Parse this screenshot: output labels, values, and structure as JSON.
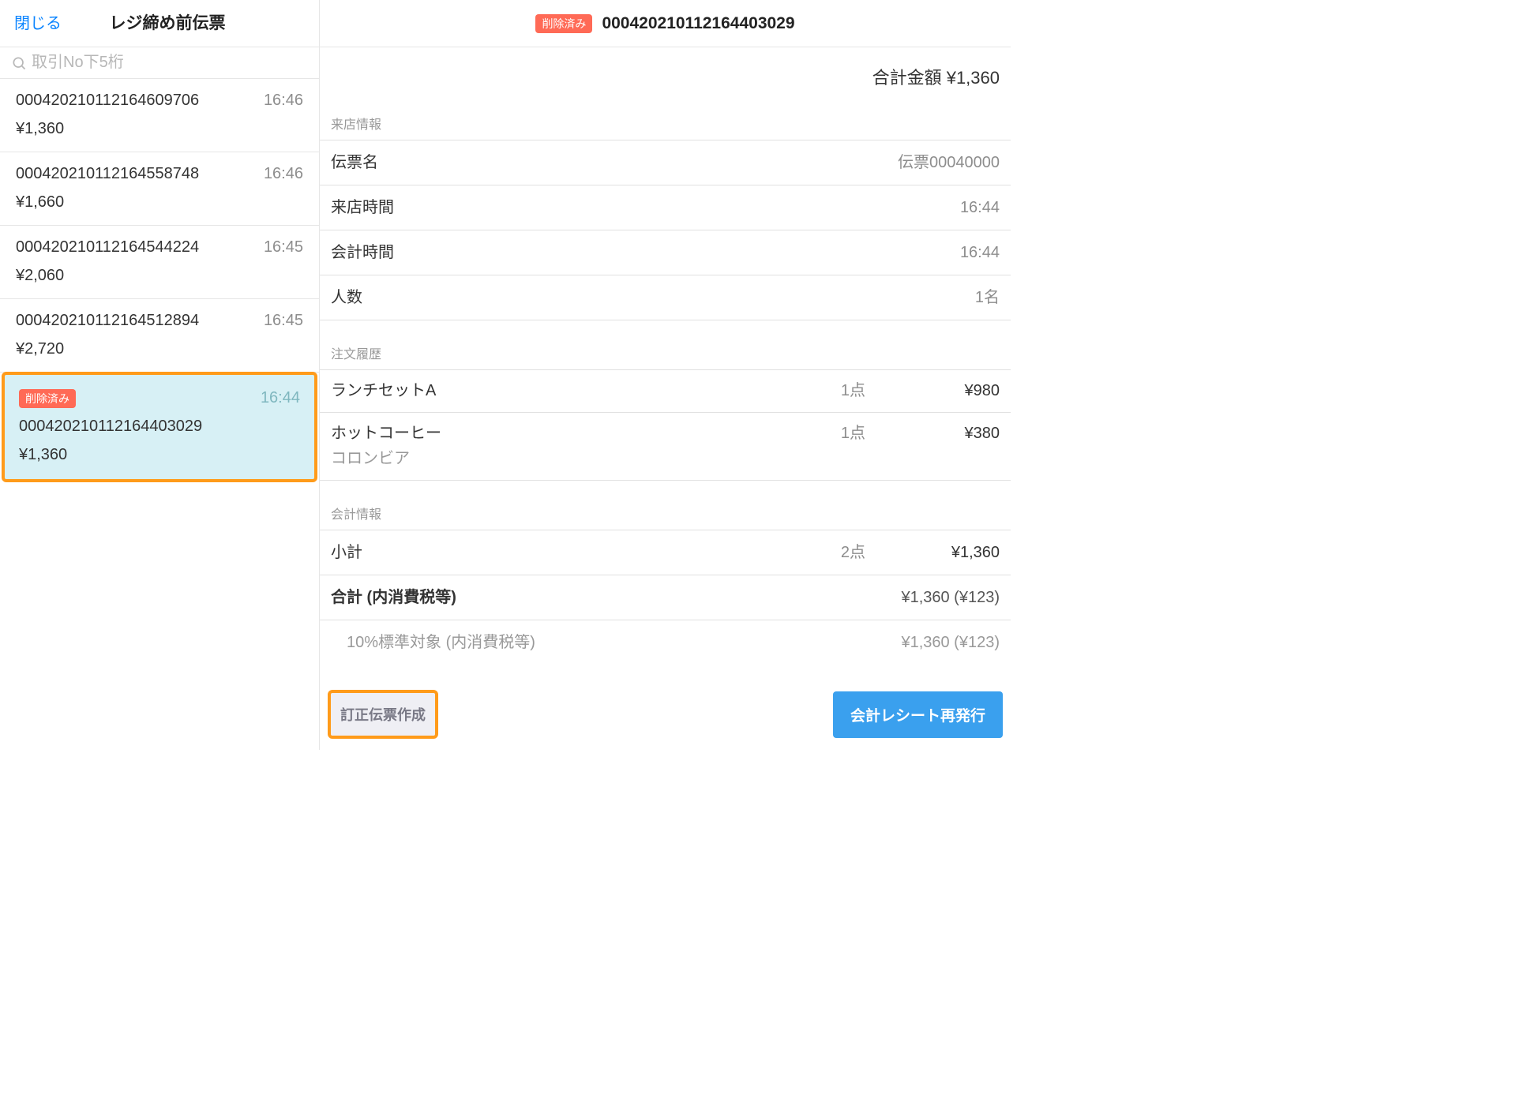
{
  "sidebar": {
    "close_label": "閉じる",
    "title": "レジ締め前伝票",
    "search_placeholder": "取引No下5桁"
  },
  "badge_deleted_label": "削除済み",
  "transactions": [
    {
      "txnno": "000420210112164609706",
      "time": "16:46",
      "amount": "¥1,360"
    },
    {
      "txnno": "000420210112164558748",
      "time": "16:46",
      "amount": "¥1,660"
    },
    {
      "txnno": "000420210112164544224",
      "time": "16:45",
      "amount": "¥2,060"
    },
    {
      "txnno": "000420210112164512894",
      "time": "16:45",
      "amount": "¥2,720"
    },
    {
      "txnno": "000420210112164403029",
      "time": "16:44",
      "amount": "¥1,360",
      "deleted": true,
      "selected": true
    }
  ],
  "detail": {
    "header_txnno": "000420210112164403029",
    "total_label": "合計金額 ¥1,360",
    "visit_section": "来店情報",
    "rows": {
      "slip_name_label": "伝票名",
      "slip_name_value": "伝票00040000",
      "visit_time_label": "来店時間",
      "visit_time_value": "16:44",
      "checkout_time_label": "会計時間",
      "checkout_time_value": "16:44",
      "people_label": "人数",
      "people_value": "1名"
    },
    "order_section": "注文履歴",
    "orders": [
      {
        "name": "ランチセットA",
        "qty": "1点",
        "price": "¥980"
      },
      {
        "name": "ホットコーヒー",
        "qty": "1点",
        "price": "¥380",
        "sub": "コロンビア"
      }
    ],
    "cash_section": "会計情報",
    "subtotal": {
      "label": "小計",
      "qty": "2点",
      "price": "¥1,360"
    },
    "grandtotal": {
      "label": "合計 (内消費税等)",
      "value": "¥1,360 (¥123)"
    },
    "taxline": {
      "label": "10%標準対象 (内消費税等)",
      "value": "¥1,360 (¥123)"
    },
    "buttons": {
      "correction": "訂正伝票作成",
      "reissue": "会計レシート再発行"
    }
  }
}
